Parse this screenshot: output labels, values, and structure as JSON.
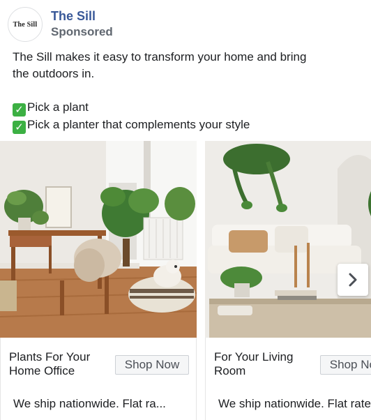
{
  "advertiser": {
    "name": "The Sill",
    "logo_text": "The Sill",
    "sponsored_label": "Sponsored"
  },
  "post": {
    "text_line1": "The Sill makes it easy to transform your home and bring",
    "text_line2": "the outdoors in.",
    "bullet1": "Pick a plant",
    "bullet2": "Pick a planter that complements your style"
  },
  "carousel": {
    "cards": [
      {
        "title": "Plants For Your Home Office",
        "cta": "Shop Now",
        "description": "We ship nationwide. Flat ra..."
      },
      {
        "title": "For Your Living Room",
        "cta": "Shop Now",
        "description": "We ship nationwide. Flat rate"
      }
    ]
  },
  "colors": {
    "name_link": "#385898",
    "secondary_text": "#606770",
    "check_emoji": "#3cb043"
  },
  "icons": {
    "check": "white-heavy-check-mark-icon",
    "next": "chevron-right-icon"
  }
}
